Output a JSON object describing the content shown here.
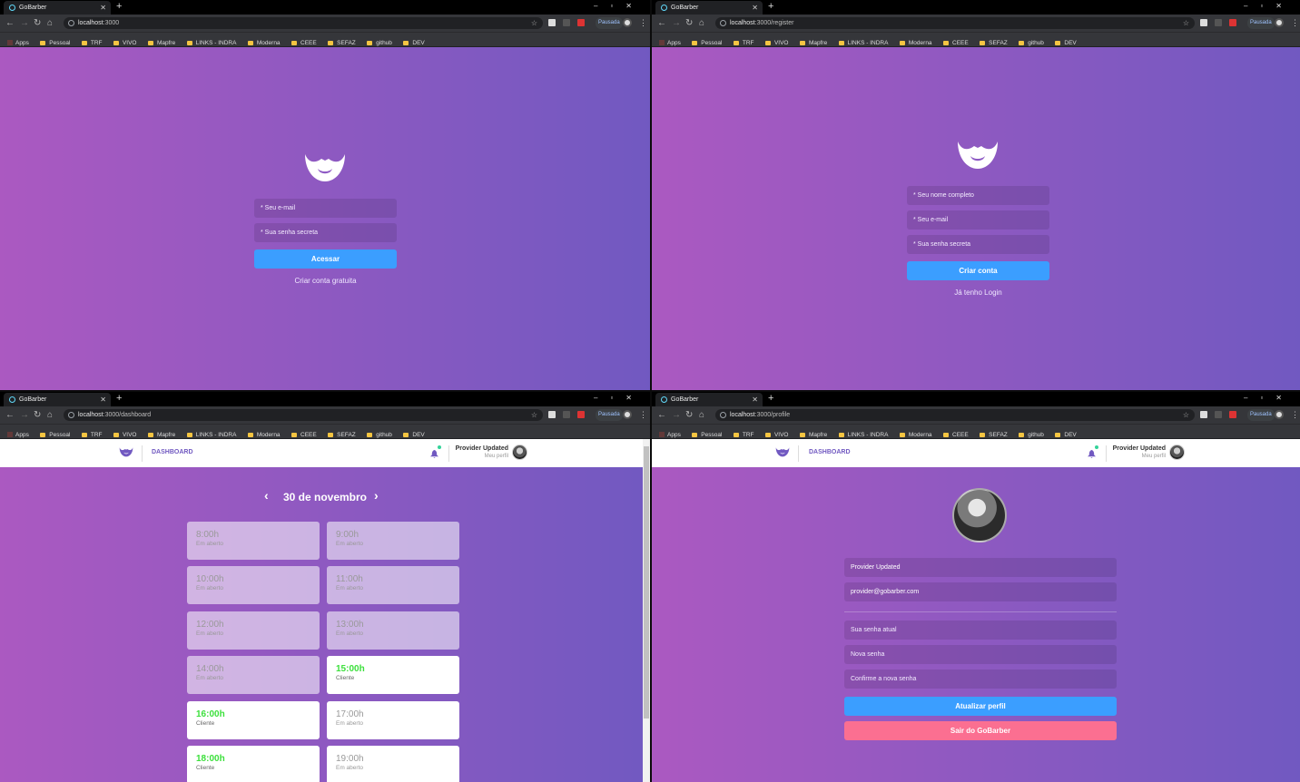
{
  "browser": {
    "tab_title": "GoBarber",
    "new_tab": "+",
    "paused_label": "Pausada",
    "bookmarks": [
      "Apps",
      "Pessoal",
      "TRF",
      "VIVO",
      "Mapfre",
      "LINKS - INDRA",
      "Moderna",
      "CEEE",
      "SEFAZ",
      "github",
      "DEV"
    ]
  },
  "windows": [
    {
      "url_host": "localhost",
      "url_path": ":3000"
    },
    {
      "url_host": "localhost",
      "url_path": ":3000/register"
    },
    {
      "url_host": "localhost",
      "url_path": ":3000/dashboard"
    },
    {
      "url_host": "localhost",
      "url_path": ":3000/profile"
    }
  ],
  "login": {
    "email_placeholder": "* Seu e-mail",
    "password_placeholder": "* Sua senha secreta",
    "submit": "Acessar",
    "link": "Criar conta gratuita"
  },
  "register": {
    "name_placeholder": "* Seu nome completo",
    "email_placeholder": "* Seu e-mail",
    "password_placeholder": "* Sua senha secreta",
    "submit": "Criar conta",
    "link": "Já tenho Login"
  },
  "header": {
    "nav_label": "DASHBOARD",
    "user_name": "Provider Updated",
    "profile_link": "Meu perfil"
  },
  "dashboard": {
    "date": "30 de novembro",
    "slots": [
      {
        "time": "8:00h",
        "status": "Em aberto",
        "state": "past"
      },
      {
        "time": "9:00h",
        "status": "Em aberto",
        "state": "past"
      },
      {
        "time": "10:00h",
        "status": "Em aberto",
        "state": "past"
      },
      {
        "time": "11:00h",
        "status": "Em aberto",
        "state": "past"
      },
      {
        "time": "12:00h",
        "status": "Em aberto",
        "state": "past"
      },
      {
        "time": "13:00h",
        "status": "Em aberto",
        "state": "past"
      },
      {
        "time": "14:00h",
        "status": "Em aberto",
        "state": "past"
      },
      {
        "time": "15:00h",
        "status": "Cliente",
        "state": "booked"
      },
      {
        "time": "16:00h",
        "status": "Cliente",
        "state": "booked"
      },
      {
        "time": "17:00h",
        "status": "Em aberto",
        "state": "free"
      },
      {
        "time": "18:00h",
        "status": "Cliente",
        "state": "booked"
      },
      {
        "time": "19:00h",
        "status": "Em aberto",
        "state": "free"
      }
    ]
  },
  "profile": {
    "name_value": "Provider Updated",
    "email_value": "provider@gobarber.com",
    "old_password_placeholder": "Sua senha atual",
    "new_password_placeholder": "Nova senha",
    "confirm_password_placeholder": "Confirme a nova senha",
    "update_button": "Atualizar perfil",
    "logout_button": "Sair do GoBarber"
  },
  "colors": {
    "gradient_start": "#ab59c1",
    "gradient_end": "#7159c1",
    "primary_button": "#3b9eff",
    "danger_button": "#fb6f91",
    "booked_time": "#3ce03c"
  }
}
